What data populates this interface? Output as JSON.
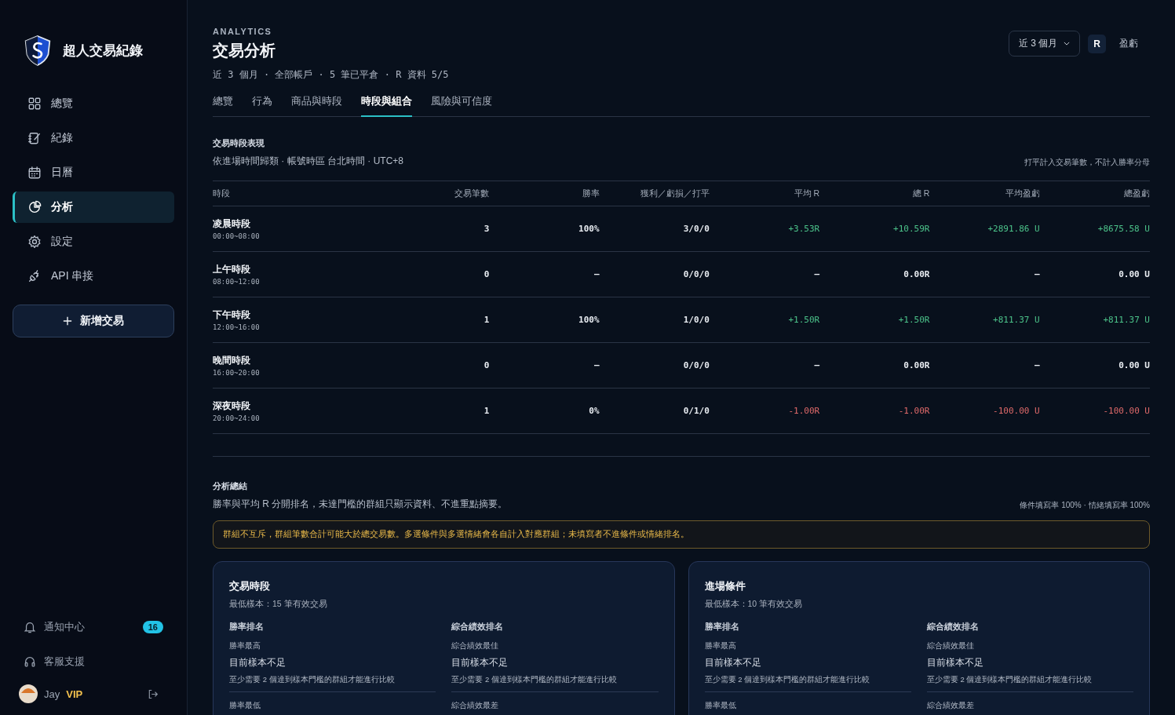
{
  "sidebar": {
    "brand": "超人交易紀錄",
    "nav": [
      {
        "label": "總覽",
        "selected": false
      },
      {
        "label": "紀錄",
        "selected": false
      },
      {
        "label": "日曆",
        "selected": false
      },
      {
        "label": "分析",
        "selected": true
      },
      {
        "label": "設定",
        "selected": false
      },
      {
        "label": "API 串接",
        "selected": false
      }
    ],
    "new_trade_button": "新增交易",
    "footer_links": [
      {
        "label": "通知中心",
        "badge": "16"
      },
      {
        "label": "客服支援"
      }
    ],
    "user": {
      "name": "Jay",
      "tier": "VIP"
    }
  },
  "header": {
    "eyebrow": "ANALYTICS",
    "title": "交易分析",
    "meta": "近 3 個月 · 全部帳戶 · 5 筆已平倉 · R 資料 5/5",
    "range_dropdown": "近 3 個月",
    "unit_toggle": [
      {
        "label": "R",
        "selected": true
      },
      {
        "label": "盈虧",
        "selected": false
      }
    ]
  },
  "tabs": [
    {
      "label": "總覽",
      "selected": false
    },
    {
      "label": "行為",
      "selected": false
    },
    {
      "label": "商品與時段",
      "selected": false
    },
    {
      "label": "時段與組合",
      "selected": true
    },
    {
      "label": "風險與可信度",
      "selected": false
    }
  ],
  "session_table": {
    "title": "交易時段表現",
    "subtitle": "依進場時間歸類 · 帳號時區 台北時間 · UTC+8",
    "note": "打平計入交易筆數，不計入勝率分母",
    "name_column": "時段",
    "columns": [
      "交易筆數",
      "勝率",
      "獲利／虧損／打平",
      "平均 R",
      "總 R",
      "平均盈虧",
      "總盈虧"
    ],
    "rows": [
      {
        "name": "凌晨時段",
        "hours": "00:00~08:00",
        "kind": "gain",
        "cells": [
          "3",
          "100%",
          "3/0/0",
          "+3.53R",
          "+10.59R",
          "+2891.86 U",
          "+8675.58 U"
        ]
      },
      {
        "name": "上午時段",
        "hours": "08:00~12:00",
        "kind": "none",
        "cells": [
          "0",
          "—",
          "0/0/0",
          "—",
          "0.00R",
          "—",
          "0.00 U"
        ]
      },
      {
        "name": "下午時段",
        "hours": "12:00~16:00",
        "kind": "gain",
        "cells": [
          "1",
          "100%",
          "1/0/0",
          "+1.50R",
          "+1.50R",
          "+811.37 U",
          "+811.37 U"
        ]
      },
      {
        "name": "晚間時段",
        "hours": "16:00~20:00",
        "kind": "none",
        "cells": [
          "0",
          "—",
          "0/0/0",
          "—",
          "0.00R",
          "—",
          "0.00 U"
        ]
      },
      {
        "name": "深夜時段",
        "hours": "20:00~24:00",
        "kind": "loss",
        "cells": [
          "1",
          "0%",
          "0/1/0",
          "-1.00R",
          "-1.00R",
          "-100.00 U",
          "-100.00 U"
        ]
      }
    ]
  },
  "summary": {
    "title": "分析總結",
    "description": "勝率與平均 R 分開排名，未達門檻的群組只顯示資料、不進重點摘要。",
    "fill_rates": "條件填寫率 100% · 情緒填寫率 100%",
    "warning": "群組不互斥，群組筆數合計可能大於總交易數。多選條件與多選情緒會各自計入對應群組；未填寫者不進條件或情緒排名。",
    "cards": [
      {
        "title": "交易時段",
        "min_sample": "最低樣本：15 筆有效交易",
        "columns": [
          {
            "heading": "勝率排名",
            "entries": [
              {
                "label": "勝率最高",
                "value": "目前樣本不足",
                "note": "至少需要 2 個達到樣本門檻的群組才能進行比較"
              },
              {
                "label": "勝率最低"
              }
            ]
          },
          {
            "heading": "綜合績效排名",
            "entries": [
              {
                "label": "綜合績效最佳",
                "value": "目前樣本不足",
                "note": "至少需要 2 個達到樣本門檻的群組才能進行比較"
              },
              {
                "label": "綜合績效最差"
              }
            ]
          }
        ]
      },
      {
        "title": "進場條件",
        "min_sample": "最低樣本：10 筆有效交易",
        "columns": [
          {
            "heading": "勝率排名",
            "entries": [
              {
                "label": "勝率最高",
                "value": "目前樣本不足",
                "note": "至少需要 2 個達到樣本門檻的群組才能進行比較"
              },
              {
                "label": "勝率最低"
              }
            ]
          },
          {
            "heading": "綜合績效排名",
            "entries": [
              {
                "label": "綜合績效最佳",
                "value": "目前樣本不足",
                "note": "至少需要 2 個達到樣本門檻的群組才能進行比較"
              },
              {
                "label": "綜合績效最差"
              }
            ]
          }
        ]
      }
    ]
  }
}
